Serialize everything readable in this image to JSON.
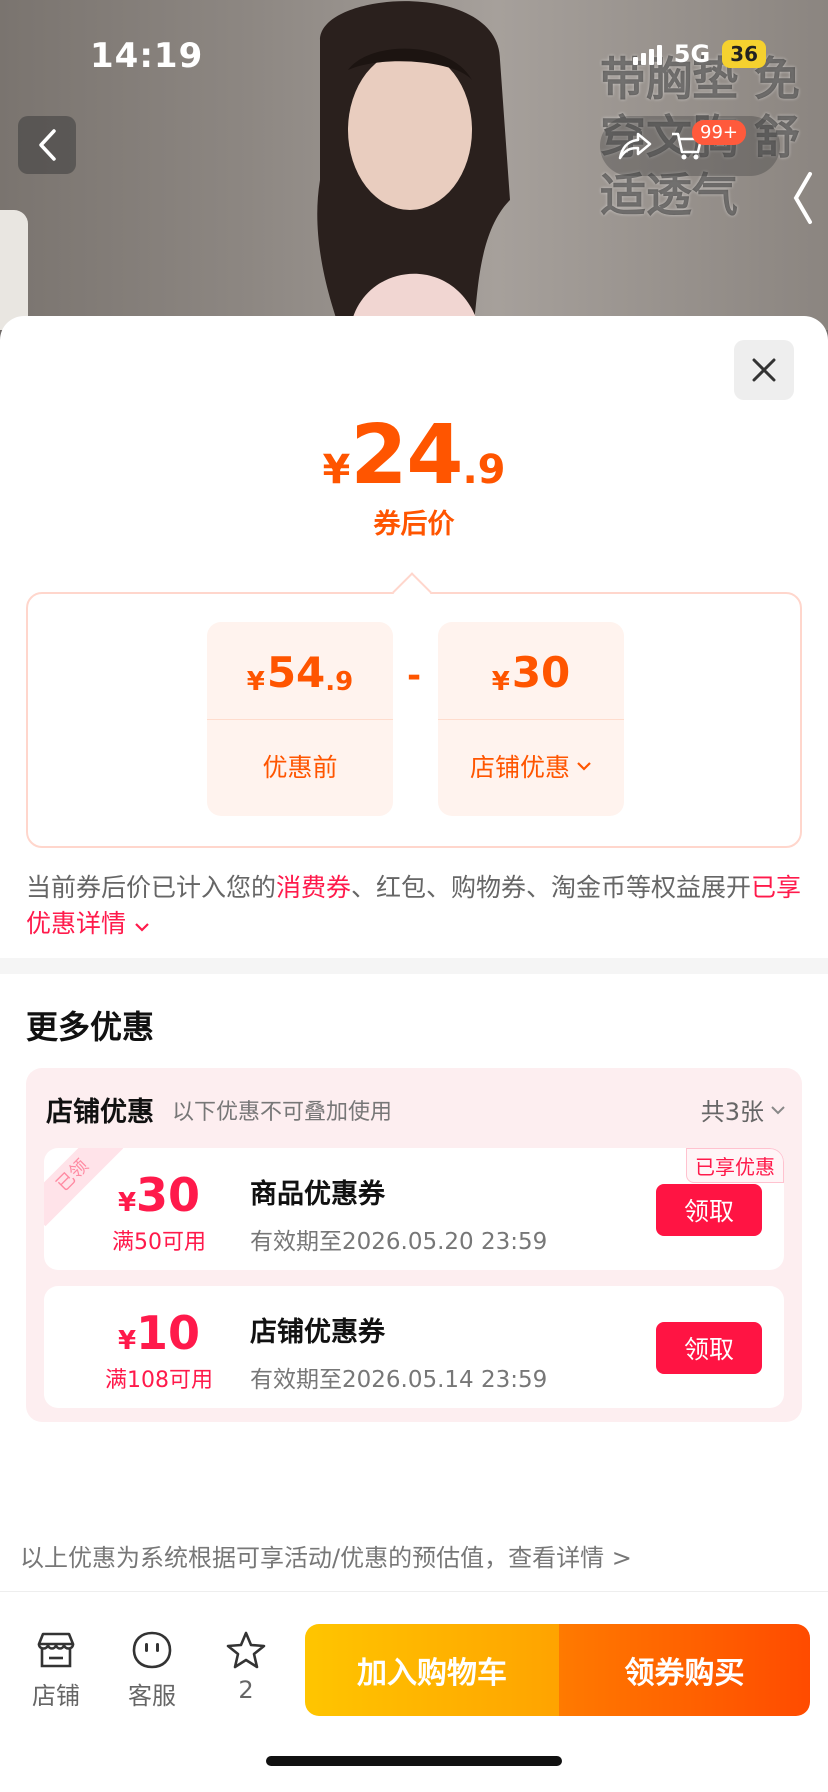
{
  "status_bar": {
    "time": "14:19",
    "network": "5G",
    "battery": "36"
  },
  "hero": {
    "banner_text": "带胸垫 免穿文胸 舒适透气",
    "cart_badge": "99+"
  },
  "sheet": {
    "price": {
      "currency": "¥",
      "integer": "24",
      "decimal": ".9",
      "label": "券后价"
    },
    "calc": {
      "before": {
        "currency": "¥",
        "integer": "54",
        "decimal": ".9",
        "label": "优惠前"
      },
      "operator": "-",
      "shop": {
        "currency": "¥",
        "integer": "30",
        "label": "店铺优惠"
      }
    },
    "note": {
      "p1": "当前券后价已计入您的",
      "red1": "消费券",
      "p2": "、红包、购物券、淘金币等权益展开",
      "red2": "已享优惠详情"
    },
    "more_title": "更多优惠",
    "shop_panel": {
      "title": "店铺优惠",
      "subtitle": "以下优惠不可叠加使用",
      "count": "共3张",
      "coupons": [
        {
          "currency": "¥",
          "amount": "30",
          "condition": "满50可用",
          "name": "商品优惠券",
          "validity": "有效期至2026.05.20 23:59",
          "button": "领取",
          "tag": "已享优惠",
          "ribbon": "已领"
        },
        {
          "currency": "¥",
          "amount": "10",
          "condition": "满108可用",
          "name": "店铺优惠券",
          "validity": "有效期至2026.05.14 23:59",
          "button": "领取"
        }
      ]
    },
    "footnote": "以上优惠为系统根据可享活动/优惠的预估值，查看详情 >"
  },
  "bottom_bar": {
    "store": "店铺",
    "service": "客服",
    "favorites": "2",
    "add_to_cart": "加入购物车",
    "buy": "领券购买"
  },
  "colors": {
    "accent_orange": "#ff5500",
    "accent_red": "#ff1443",
    "cta_yellow": "#ffb000",
    "cta_orange": "#ff5a00"
  },
  "icons": [
    "chevron-left-icon",
    "close-icon",
    "chevron-down-icon",
    "store-icon",
    "customer-service-icon",
    "star-icon",
    "share-icon",
    "cart-icon"
  ]
}
